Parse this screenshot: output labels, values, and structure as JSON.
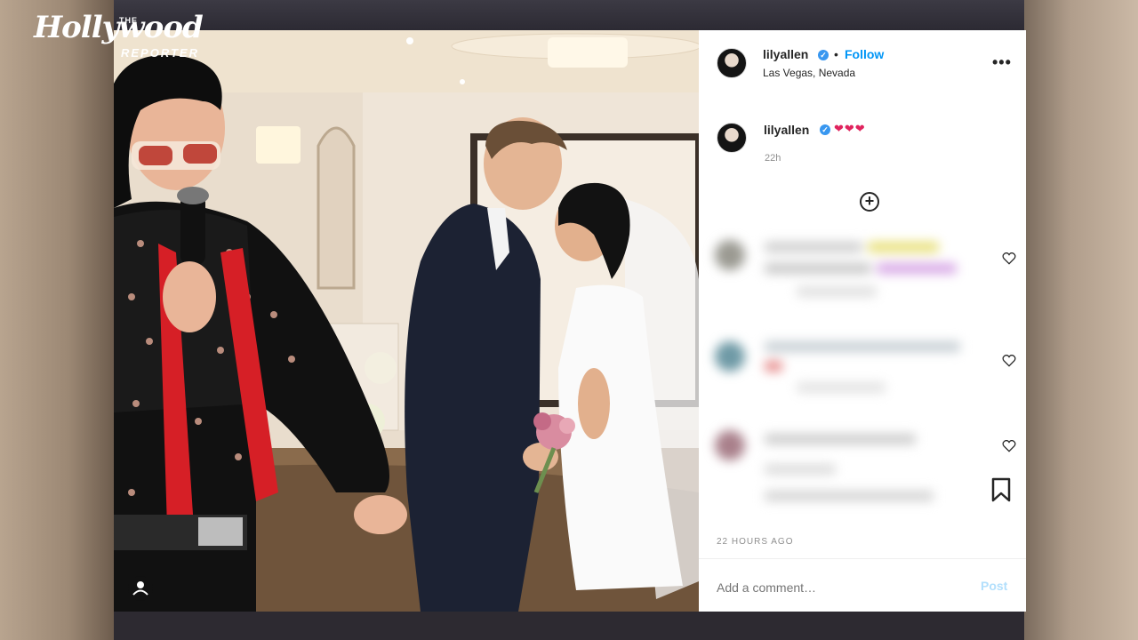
{
  "watermark": {
    "the": "THE",
    "main": "Hollywood",
    "reporter": "REPORTER"
  },
  "post": {
    "username": "lilyallen",
    "verified_mark": "✓",
    "separator": "•",
    "follow_label": "Follow",
    "location": "Las Vegas, Nevada",
    "more_label": "•••",
    "caption": "❤❤❤",
    "caption_time": "22h",
    "load_more_label": "+",
    "timestamp": "22 HOURS AGO",
    "comment_placeholder": "Add a comment…",
    "post_label": "Post"
  },
  "icons": {
    "verified": "verified-badge-icon",
    "more": "more-options-icon",
    "load_more": "plus-circle-icon",
    "like": "heart-icon",
    "save": "bookmark-icon"
  },
  "colors": {
    "link_blue": "#0095f6",
    "verified_blue": "#3897f0",
    "heart_red": "#e0245e",
    "muted_gray": "#8e8e8e"
  }
}
